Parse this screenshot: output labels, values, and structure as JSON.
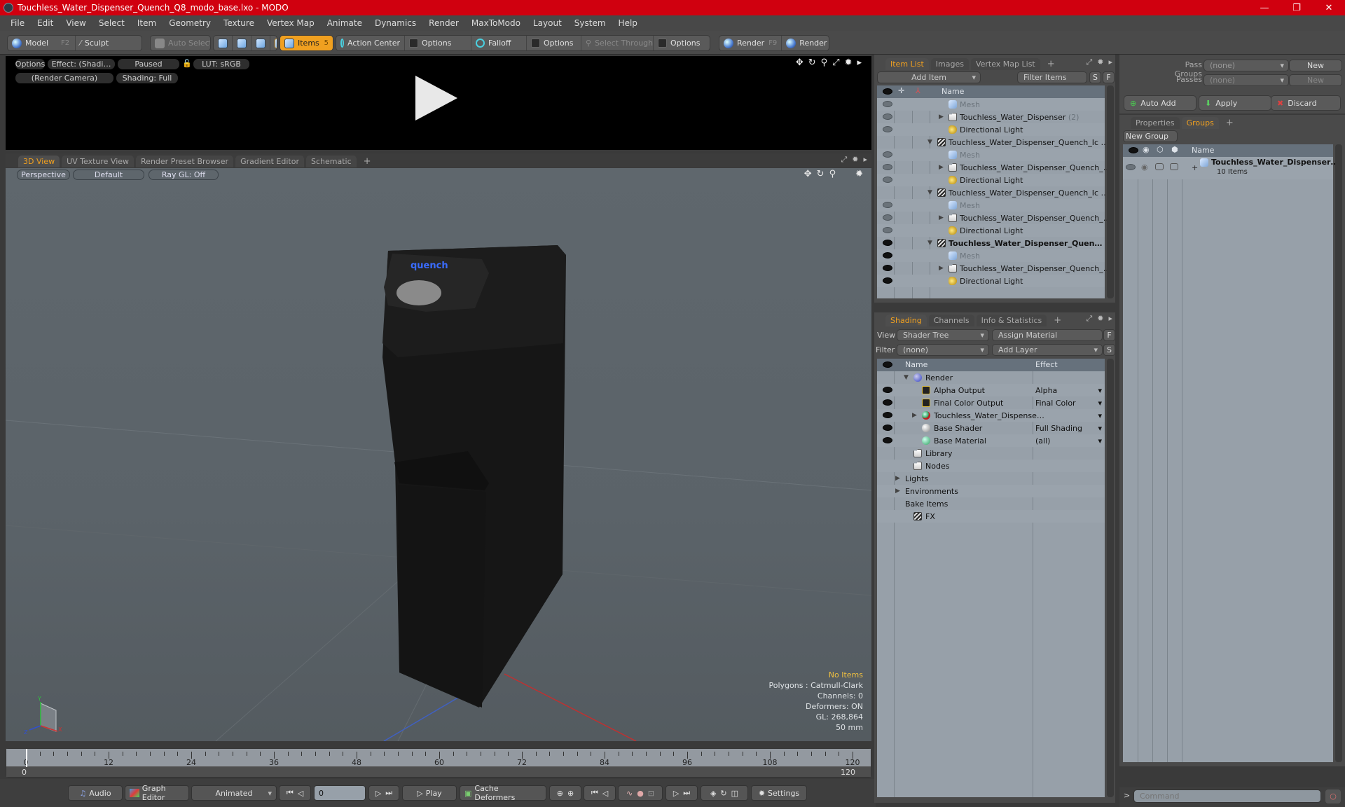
{
  "window": {
    "title": "Touchless_Water_Dispenser_Quench_Q8_modo_base.lxo - MODO",
    "controls": {
      "minimize": "—",
      "restore": "❐",
      "close": "✕"
    }
  },
  "menubar": [
    "File",
    "Edit",
    "View",
    "Select",
    "Item",
    "Geometry",
    "Texture",
    "Vertex Map",
    "Animate",
    "Dynamics",
    "Render",
    "MaxToModo",
    "Layout",
    "System",
    "Help"
  ],
  "toolbar": {
    "model": "Model",
    "model_key": "F2",
    "sculpt": "Sculpt",
    "auto_select": "Auto Select",
    "items": "Items",
    "items_count": "5",
    "action_center": "Action Center",
    "options1": "Options",
    "falloff": "Falloff",
    "options2": "Options",
    "select_through": "Select Through",
    "options3": "Options",
    "render": "Render",
    "render_key": "F9",
    "render_window": "Render Window"
  },
  "preview": {
    "options": "Options",
    "effect": "Effect: (Shadi…",
    "status": "Paused",
    "lut": "LUT: sRGB",
    "camera": "(Render Camera)",
    "shading": "Shading: Full",
    "icons": [
      "move-icon",
      "rotate-icon",
      "zoom-icon",
      "maximize-icon",
      "gear-icon",
      "arrow-right-icon"
    ]
  },
  "viewport_tabs": [
    "3D View",
    "UV Texture View",
    "Render Preset Browser",
    "Gradient Editor",
    "Schematic",
    "+"
  ],
  "viewport": {
    "projection": "Perspective",
    "style": "Default",
    "raygl": "Ray GL: Off",
    "model_label": "quench",
    "stats": {
      "selection": "No Items",
      "polygons": "Polygons : Catmull-Clark",
      "channels": "Channels: 0",
      "deformers": "Deformers: ON",
      "gl": "GL: 268,864",
      "focal": "50 mm"
    },
    "axis": {
      "x": "X",
      "y": "Y",
      "z": "Z"
    }
  },
  "timeline": {
    "ticks": [
      "0",
      "12",
      "24",
      "36",
      "48",
      "60",
      "72",
      "84",
      "96",
      "108",
      "120"
    ],
    "range_start": "0",
    "range_end": "120",
    "current_frame": 0
  },
  "transport": {
    "audio": "Audio",
    "graph_editor": "Graph Editor",
    "mode": "Animated",
    "frame": "0",
    "play": "Play",
    "cache_deformers": "Cache Deformers",
    "settings": "Settings"
  },
  "item_list": {
    "tabs": [
      "Item List",
      "Images",
      "Vertex Map List",
      "+"
    ],
    "add_item": "Add Item",
    "filter": "Filter Items",
    "s": "S",
    "f": "F",
    "header": {
      "name": "Name"
    },
    "rows": [
      {
        "label": "Mesh",
        "type": "mesh",
        "indent": 2,
        "dim": true,
        "eye": "dim"
      },
      {
        "label": "Touchless_Water_Dispenser",
        "suffix": "(2)",
        "type": "folder",
        "indent": 2,
        "expander": "▶",
        "eye": "dim"
      },
      {
        "label": "Directional Light",
        "type": "light",
        "indent": 2,
        "eye": "dim"
      },
      {
        "label": "Touchless_Water_Dispenser_Quench_Ic …",
        "type": "scene",
        "indent": 1,
        "expander": "▼",
        "eye": "none"
      },
      {
        "label": "Mesh",
        "type": "mesh",
        "indent": 2,
        "dim": true,
        "eye": "dim"
      },
      {
        "label": "Touchless_Water_Dispenser_Quench_…",
        "type": "folder",
        "indent": 2,
        "expander": "▶",
        "eye": "dim"
      },
      {
        "label": "Directional Light",
        "type": "light",
        "indent": 2,
        "eye": "dim"
      },
      {
        "label": "Touchless_Water_Dispenser_Quench_Ic …",
        "type": "scene",
        "indent": 1,
        "expander": "▼",
        "eye": "none"
      },
      {
        "label": "Mesh",
        "type": "mesh",
        "indent": 2,
        "dim": true,
        "eye": "dim"
      },
      {
        "label": "Touchless_Water_Dispenser_Quench_…",
        "type": "folder",
        "indent": 2,
        "expander": "▶",
        "eye": "dim"
      },
      {
        "label": "Directional Light",
        "type": "light",
        "indent": 2,
        "eye": "dim"
      },
      {
        "label": "Touchless_Water_Dispenser_Quen…",
        "type": "scene",
        "indent": 1,
        "expander": "▼",
        "bold": true,
        "eye": "on"
      },
      {
        "label": "Mesh",
        "type": "mesh",
        "indent": 2,
        "dim": true,
        "eye": "on"
      },
      {
        "label": "Touchless_Water_Dispenser_Quench_…",
        "type": "folder",
        "indent": 2,
        "expander": "▶",
        "eye": "on"
      },
      {
        "label": "Directional Light",
        "type": "light",
        "indent": 2,
        "eye": "on"
      }
    ]
  },
  "shading": {
    "tabs": [
      "Shading",
      "Channels",
      "Info & Statistics",
      "+"
    ],
    "view_label": "View",
    "view_value": "Shader Tree",
    "assign_material": "Assign Material",
    "f": "F",
    "filter_label": "Filter",
    "filter_value": "(none)",
    "add_layer": "Add Layer",
    "s": "S",
    "header": {
      "name": "Name",
      "effect": "Effect"
    },
    "rows": [
      {
        "label": "Render",
        "icon": "render",
        "indent": 1,
        "expander": "▼",
        "effect": "",
        "eye": false,
        "dropdown": false
      },
      {
        "label": "Alpha Output",
        "icon": "output",
        "indent": 2,
        "effect": "Alpha",
        "eye": true,
        "dropdown": true
      },
      {
        "label": "Final Color Output",
        "icon": "output",
        "indent": 2,
        "effect": "Final Color",
        "eye": true,
        "dropdown": true
      },
      {
        "label": "Touchless_Water_Dispense…",
        "icon": "material-group",
        "indent": 2,
        "expander": "▶",
        "effect": "",
        "eye": true,
        "dropdown": true
      },
      {
        "label": "Base Shader",
        "icon": "shader",
        "indent": 2,
        "effect": "Full Shading",
        "eye": true,
        "dropdown": true
      },
      {
        "label": "Base Material",
        "icon": "material",
        "indent": 2,
        "effect": "(all)",
        "eye": true,
        "dropdown": true
      },
      {
        "label": "Library",
        "icon": "folder",
        "indent": 1,
        "effect": "",
        "eye": false,
        "dropdown": false
      },
      {
        "label": "Nodes",
        "icon": "folder",
        "indent": 1,
        "effect": "",
        "eye": false,
        "dropdown": false
      },
      {
        "label": "Lights",
        "icon": "none",
        "indent": 0,
        "expander": "▶",
        "effect": "",
        "eye": false,
        "dropdown": false
      },
      {
        "label": "Environments",
        "icon": "none",
        "indent": 0,
        "expander": "▶",
        "effect": "",
        "eye": false,
        "dropdown": false
      },
      {
        "label": "Bake Items",
        "icon": "none",
        "indent": 0,
        "effect": "",
        "eye": false,
        "dropdown": false
      },
      {
        "label": "FX",
        "icon": "scene",
        "indent": 1,
        "effect": "",
        "eye": false,
        "dropdown": false
      }
    ]
  },
  "passes": {
    "pass_groups_label": "Pass Groups",
    "pass_groups_value": "(none)",
    "new1": "New",
    "passes_label": "Passes",
    "passes_value": "(none)",
    "new2": "New",
    "auto_add": "Auto Add",
    "apply": "Apply",
    "discard": "Discard"
  },
  "groups": {
    "tabs": [
      "Properties",
      "Groups",
      "+"
    ],
    "new_group": "New Group",
    "header": {
      "name": "Name"
    },
    "rows": [
      {
        "label": "Touchless_Water_Dispenser…",
        "sub": "10 Items"
      }
    ]
  },
  "command": {
    "prompt": ">",
    "placeholder": "Command"
  },
  "colors": {
    "accent": "#f0a020",
    "titlebar": "#d0000f",
    "brand_blue": "#3a6cff"
  }
}
